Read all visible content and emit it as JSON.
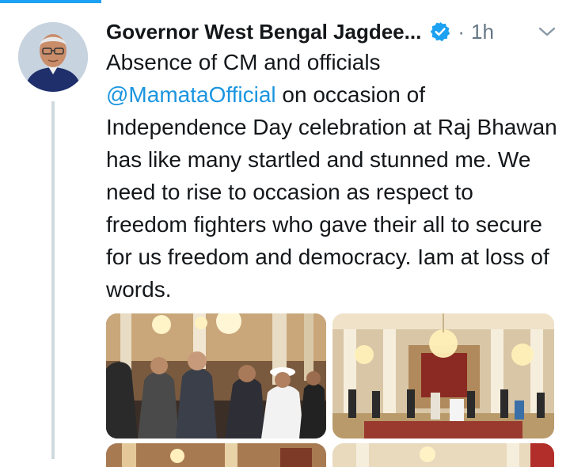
{
  "tweet": {
    "author_name": "Governor West Bengal Jagdee...",
    "separator": "·",
    "time": "1h",
    "text_before": "Absence of CM and officials",
    "mention": "@MamataOfficial",
    "text_after": "on occasion of Independence Day celebration at Raj Bhawan has like many startled and stunned me. We need to rise to occasion as respect to freedom fighters who gave their all to secure for us freedom and democracy. Iam at loss of words."
  },
  "icons": {
    "verified": "verified-badge-icon",
    "caret": "chevron-down-icon"
  },
  "colors": {
    "accent": "#1da1f2",
    "mention": "#1b95e0",
    "muted": "#657786",
    "thread_line": "#cfd9de"
  }
}
